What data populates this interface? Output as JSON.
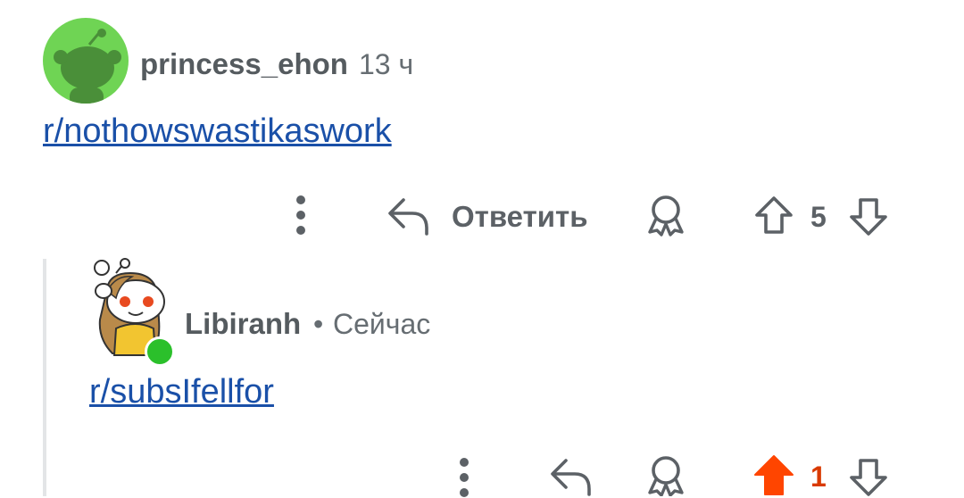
{
  "comment1": {
    "username": "princess_ehon",
    "time": "13 ч",
    "body_link": "r/nothowswastikaswork",
    "actions": {
      "more_icon": "more-vertical-icon",
      "reply_icon": "reply-arrow-icon",
      "reply_label": "Ответить",
      "award_icon": "award-ribbon-icon",
      "upvote_icon": "upvote-arrow-icon",
      "score": "5",
      "downvote_icon": "downvote-arrow-icon"
    }
  },
  "comment2": {
    "username": "Libiranh",
    "separator": "•",
    "time": "Сейчас",
    "online": true,
    "body_link": "r/subsIfellfor",
    "actions": {
      "more_icon": "more-vertical-icon",
      "reply_icon": "reply-arrow-icon",
      "award_icon": "award-ribbon-icon",
      "upvote_icon": "upvote-arrow-filled-icon",
      "upvoted": true,
      "score": "1",
      "downvote_icon": "downvote-arrow-icon"
    }
  },
  "colors": {
    "accent_upvote": "#ff4500",
    "score_active": "#d93a00",
    "link": "#1a50a8",
    "online": "#2bc02b",
    "avatar_bg": "#6fd454"
  }
}
